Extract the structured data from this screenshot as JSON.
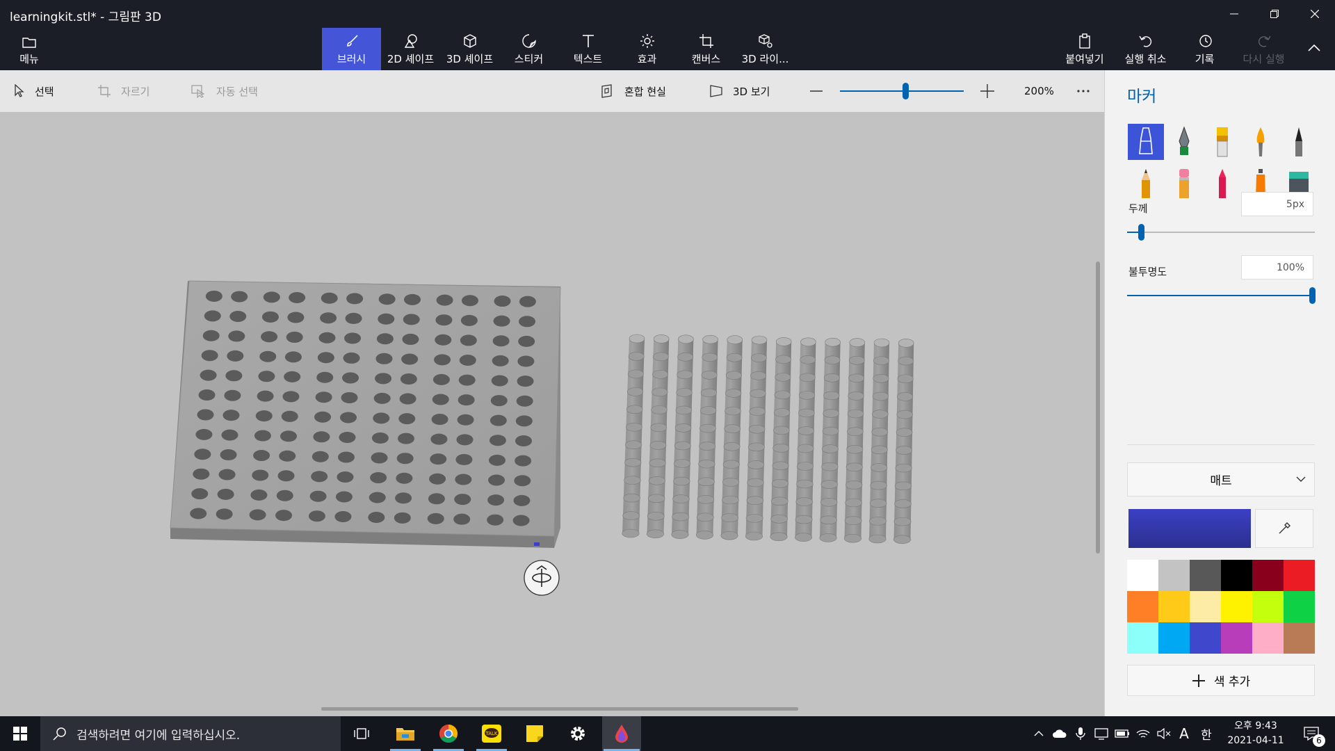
{
  "window": {
    "title": "learningkit.stl* - 그림판 3D"
  },
  "ribbon": {
    "menu": "메뉴",
    "brushes": "브러시",
    "shapes2d": "2D 셰이프",
    "shapes3d": "3D 셰이프",
    "stickers": "스티커",
    "text": "텍스트",
    "effects": "효과",
    "canvas": "캔버스",
    "library3d": "3D 라이...",
    "paste": "붙여넣기",
    "undo": "실행 취소",
    "history": "기록",
    "redo": "다시 실행"
  },
  "toolbar": {
    "select": "선택",
    "crop": "자르기",
    "magic_select": "자동 선택",
    "mixed_reality": "혼합 현실",
    "view3d": "3D 보기",
    "zoom_level": "200%",
    "zoom_fraction": 0.53
  },
  "panel": {
    "title": "마커",
    "thickness_label": "두께",
    "thickness_value": "5px",
    "thickness_fraction": 0.06,
    "opacity_label": "불투명도",
    "opacity_value": "100%",
    "opacity_fraction": 1.0,
    "finish": "매트",
    "current_color": "#3b40c4",
    "add_color": "색 추가",
    "palette": [
      "#ffffff",
      "#c3c3c3",
      "#585858",
      "#000000",
      "#88001b",
      "#ec1c24",
      "#ff7f27",
      "#ffca18",
      "#fdeca6",
      "#fff200",
      "#c4ff0e",
      "#0ed145",
      "#8cfffb",
      "#00a8f3",
      "#3f48cc",
      "#b83dba",
      "#ffaec8",
      "#b97a56"
    ]
  },
  "taskbar": {
    "search_placeholder": "검색하려면 여기에 입력하십시오.",
    "time": "오후 9:43",
    "date": "2021-04-11",
    "ime": "A",
    "ime2": "한",
    "notifications": "6"
  }
}
